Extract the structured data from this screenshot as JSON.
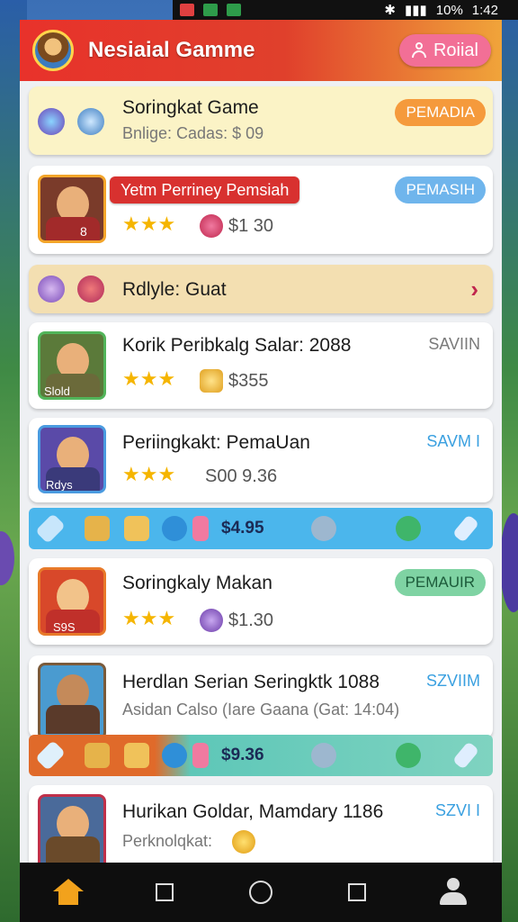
{
  "status_bar": {
    "battery": "10%",
    "time": "1:42"
  },
  "header": {
    "title": "Nesiaial Gamme",
    "role_button": "Roiial"
  },
  "items": [
    {
      "title": "Soringkat Game",
      "subtitle": "Bnlige: Cadas: $ 09",
      "badge": "PEMADIA"
    },
    {
      "ribbon": "Yetm Perriney Pemsiah",
      "badge": "PEMASIH",
      "stars": "★★★",
      "price": "$1 30",
      "thumb_label": "8"
    },
    {
      "title": "Rdlyle: Guat"
    },
    {
      "title": "Korik Peribkalg Salar: 2088",
      "tag": "SAVIIN",
      "stars": "★★★",
      "price": "$355",
      "thumb_label": "Slold"
    },
    {
      "title": "Periingkakt: PemaUan",
      "tag": "SAVM I",
      "stars": "★★★",
      "price": "S00 9.36",
      "thumb_label": "Rdys"
    },
    {
      "title": "Soringkaly Makan",
      "badge": "PEMAUIR",
      "stars": "★★★",
      "price": "$1.30",
      "thumb_label": "S9S"
    },
    {
      "title": "Herdlan Serian Seringktk 1088",
      "subtitle": "Asidan Calso (Iare Gaana (Gat: 14:04)",
      "tag": "SZVIIM"
    },
    {
      "title": "Hurikan Goldar, Mamdary 1186",
      "subtitle": "Perknolqkat:",
      "tag": "SZVI I"
    }
  ],
  "toolbars": [
    {
      "price": "$4.95"
    },
    {
      "price": "$9.36"
    }
  ],
  "nav": [
    "home",
    "recents",
    "home-circle",
    "overview",
    "profile"
  ]
}
